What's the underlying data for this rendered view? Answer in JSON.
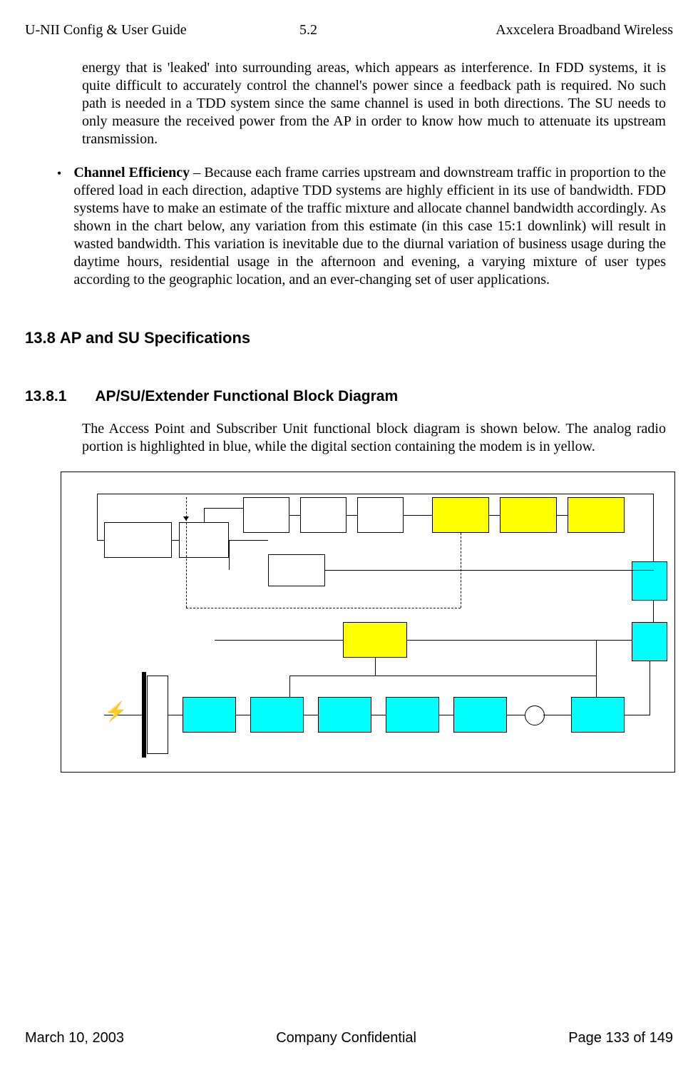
{
  "header": {
    "left": "U-NII Config & User Guide",
    "center": "5.2",
    "right": "Axxcelera Broadband Wireless"
  },
  "para1": "energy that is 'leaked' into surrounding areas, which appears as interference. In FDD systems, it is quite difficult to accurately control the channel's power since a feedback path is required. No such path is needed in a TDD system since the same channel is used in both directions. The SU needs to only measure the received power from the AP in order to know how much to attenuate its upstream transmission.",
  "bullet1": {
    "lead": "Channel Efficiency",
    "rest": " – Because each frame carries upstream and downstream traffic in proportion to the offered load in each direction, adaptive TDD systems are highly efficient in its use of bandwidth. FDD systems have to make an estimate of the traffic mixture and allocate channel bandwidth accordingly. As shown in the chart below, any variation from this estimate (in this case 15:1 downlink) will result in wasted bandwidth. This variation is inevitable due to the diurnal variation of business usage during the daytime hours, residential usage in the afternoon and evening, a varying mixture of user types according to the geographic location, and an ever-changing set of user applications."
  },
  "section": {
    "num": "13.8",
    "title": "AP and SU Specifications"
  },
  "subsection": {
    "num": "13.8.1",
    "title": "AP/SU/Extender Functional Block Diagram"
  },
  "para2": "The Access Point and Subscriber Unit functional block diagram is shown below. The analog radio portion is highlighted in blue, while the digital section containing the modem is in yellow.",
  "footer": {
    "left": "March 10, 2003",
    "center": "Company Confidential",
    "right": "Page 133 of 149"
  }
}
